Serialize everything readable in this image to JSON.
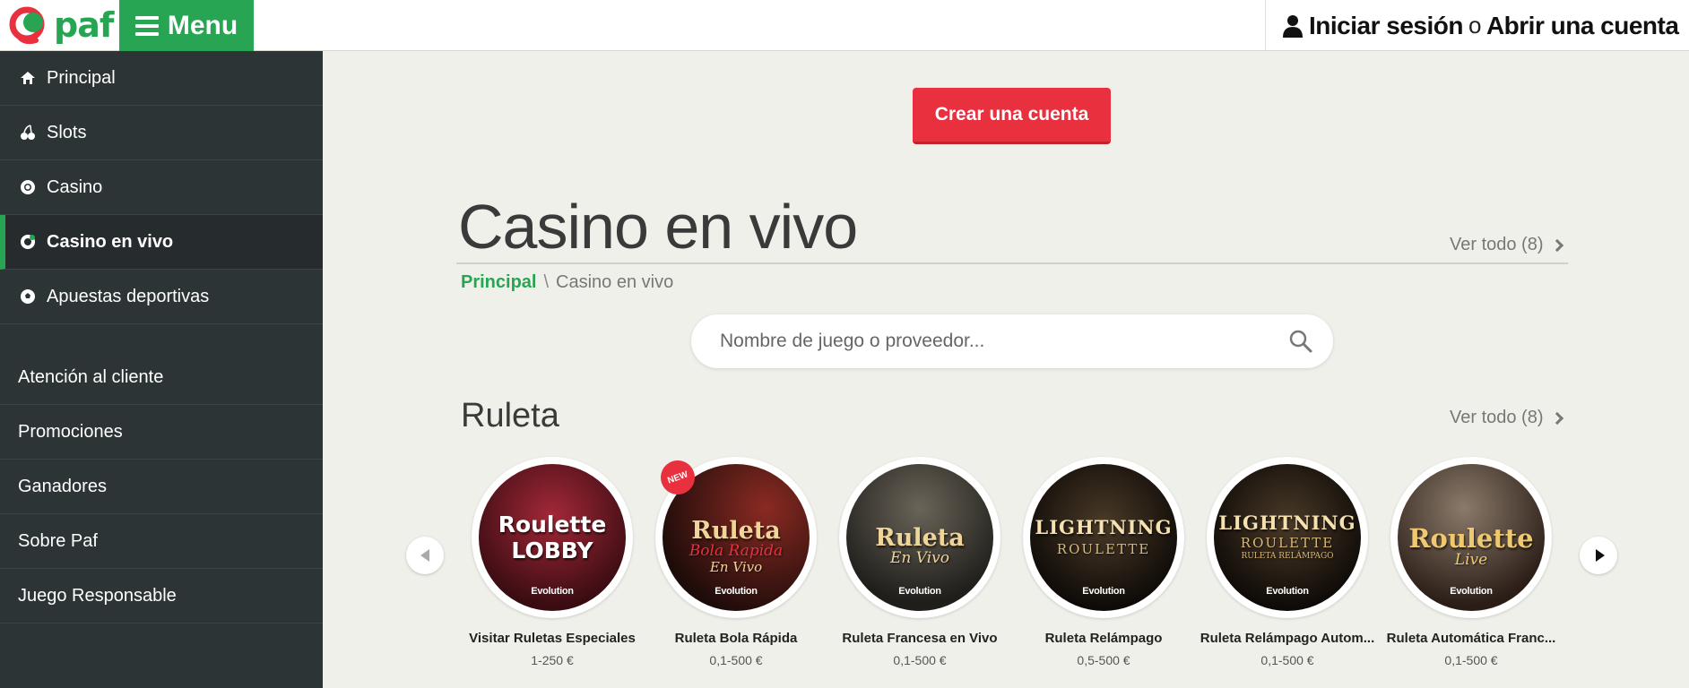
{
  "header": {
    "logo_text": "paf",
    "menu_label": "Menu",
    "login_label": "Iniciar sesión",
    "or_label": "o",
    "register_label": "Abrir una cuenta"
  },
  "sidebar": {
    "items": [
      {
        "label": "Principal",
        "icon": "home-icon"
      },
      {
        "label": "Slots",
        "icon": "cherries-icon"
      },
      {
        "label": "Casino",
        "icon": "casino-chip-icon"
      },
      {
        "label": "Casino en vivo",
        "icon": "live-casino-icon",
        "active": true
      },
      {
        "label": "Apuestas deportivas",
        "icon": "soccer-ball-icon"
      }
    ],
    "links": [
      "Atención al cliente",
      "Promociones",
      "Ganadores",
      "Sobre Paf",
      "Juego Responsable"
    ]
  },
  "main": {
    "create_button": "Crear una cuenta",
    "page_title": "Casino en vivo",
    "see_all_top": "Ver todo (8)",
    "breadcrumb": {
      "home": "Principal",
      "separator": "\\",
      "current": "Casino en vivo"
    },
    "search": {
      "placeholder": "Nombre de juego o proveedor..."
    },
    "section": {
      "title": "Ruleta",
      "see_all": "Ver todo (8)",
      "games": [
        {
          "name": "Visitar Ruletas Especiales",
          "price": "1-250 €",
          "art_line1": "Roulette",
          "art_line2": "LOBBY",
          "provider": "Evolution",
          "bg": "#7a1a24",
          "badge": ""
        },
        {
          "name": "Ruleta Bola Rápida",
          "price": "0,1-500 €",
          "art_line1": "Ruleta",
          "art_line2": "Bola Rapida",
          "art_line3": "En Vivo",
          "provider": "Evolution",
          "bg": "#4a1d1a",
          "badge": "NEW"
        },
        {
          "name": "Ruleta Francesa en Vivo",
          "price": "0,1-500 €",
          "art_line1": "Ruleta",
          "art_line2": "En Vivo",
          "provider": "Evolution",
          "bg": "#3a3a36",
          "badge": ""
        },
        {
          "name": "Ruleta Relámpago",
          "price": "0,5-500 €",
          "art_line1": "LIGHTNING",
          "art_line2": "ROULETTE",
          "provider": "Evolution",
          "bg": "#1a1410",
          "badge": ""
        },
        {
          "name": "Ruleta Relámpago Autom...",
          "price": "0,1-500 €",
          "art_line1": "LIGHTNING",
          "art_line2": "ROULETTE",
          "art_line3": "RULETA RELÁMPAGO",
          "provider": "Evolution",
          "bg": "#1c1610",
          "badge": ""
        },
        {
          "name": "Ruleta Automática Franc...",
          "price": "0,1-500 €",
          "art_line1": "Roulette",
          "art_line2": "Live",
          "provider": "Evolution",
          "bg": "#3b2a22",
          "badge": ""
        }
      ]
    }
  },
  "colors": {
    "brand_green": "#27a553",
    "cta_red": "#e8303f",
    "sidebar_bg": "#2d3436"
  }
}
